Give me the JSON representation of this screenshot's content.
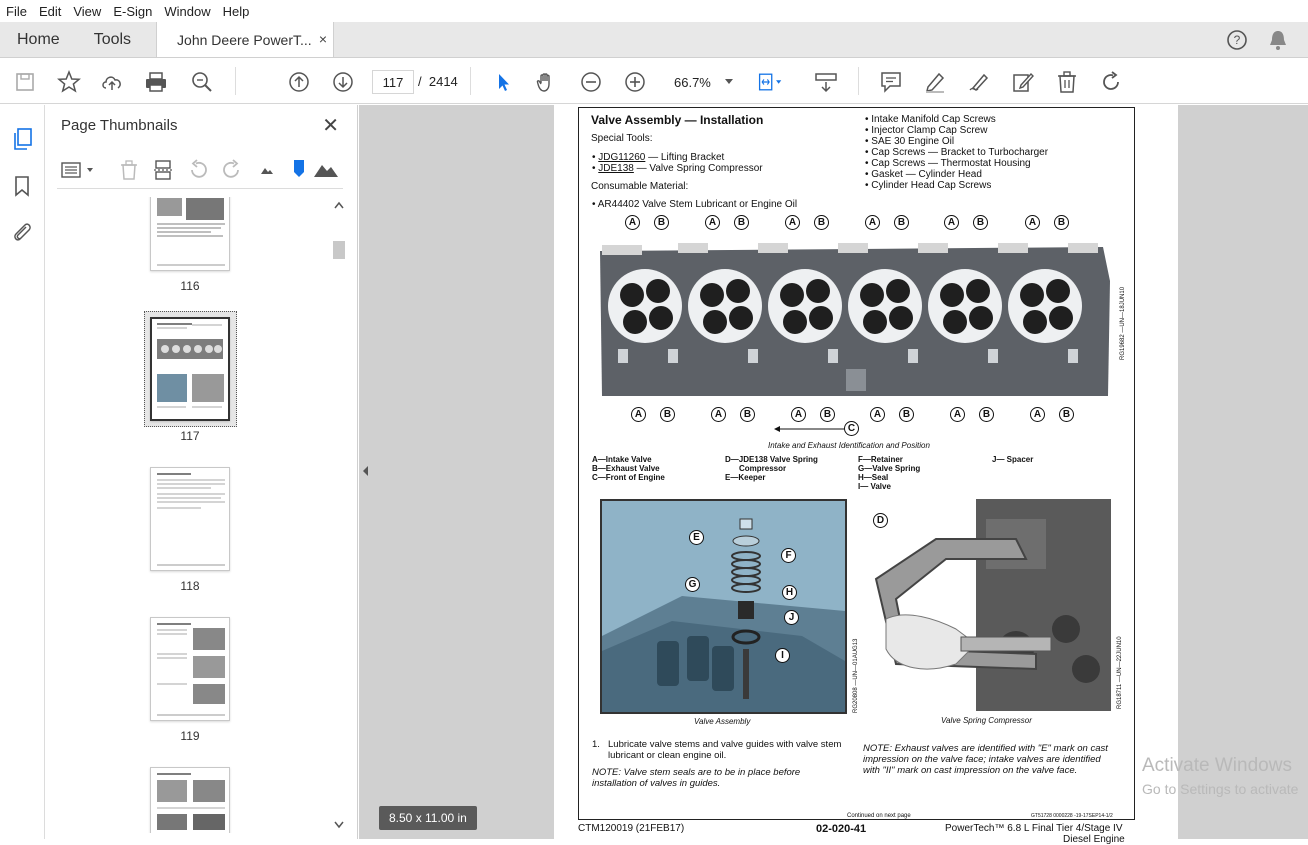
{
  "menu": [
    "File",
    "Edit",
    "View",
    "E-Sign",
    "Window",
    "Help"
  ],
  "tabs": {
    "home": "Home",
    "tools": "Tools",
    "document": "John Deere PowerT...",
    "close": "×"
  },
  "toolbar": {
    "current_page": "117",
    "page_sep": "/",
    "total_pages": "2414",
    "zoom": "66.7%"
  },
  "panel": {
    "title": "Page Thumbnails",
    "close": "✕"
  },
  "thumbnails": [
    {
      "label": "116"
    },
    {
      "label": "117"
    },
    {
      "label": "118"
    },
    {
      "label": "119"
    }
  ],
  "viewer": {
    "page_size": "8.50 x 11.00 in",
    "watermark_title": "Activate Windows",
    "watermark_sub": "Go to Settings to activate"
  },
  "document": {
    "title": "Valve Assembly — Installation",
    "special_tools_heading": "Special Tools:",
    "tools": [
      {
        "code": "JDG11260",
        "desc": " — Lifting Bracket"
      },
      {
        "code": "JDE138",
        "desc": " — Valve Spring Compressor"
      }
    ],
    "consumable_heading": "Consumable Material:",
    "consumable": "AR44402 Valve Stem Lubricant or Engine Oil",
    "right_list": [
      "Intake Manifold Cap Screws",
      "Injector Clamp Cap Screw",
      "SAE 30 Engine Oil",
      "Cap Screws — Bracket to Turbocharger",
      "Cap Screws — Thermostat Housing",
      "Gasket — Cylinder Head",
      "Cylinder Head Cap Screws"
    ],
    "callout_letters": {
      "a": "A",
      "b": "B",
      "c": "C",
      "d": "D",
      "e": "E",
      "f": "F",
      "g": "G",
      "h": "H",
      "i": "I",
      "j": "J"
    },
    "figure_id_1": "RG19682 —UN—18JUN10",
    "figure1_caption": "Intake and Exhaust Identification and Position",
    "legend": {
      "col1": [
        "A—Intake Valve",
        "B—Exhaust Valve",
        "C—Front of Engine"
      ],
      "col2": [
        "D—JDE138 Valve Spring",
        "Compressor",
        "E—Keeper"
      ],
      "col3": [
        "F—Retainer",
        "G—Valve Spring",
        "H—Seal",
        "I— Valve"
      ],
      "col4": [
        "J— Spacer"
      ]
    },
    "figure2_caption": "Valve Assembly",
    "figure2_id": "RG20808 —UN—01AUG13",
    "figure3_caption": "Valve Spring Compressor",
    "figure3_id": "RG18711 —UN—22JUN10",
    "step1_num": "1.",
    "step1": "Lubricate valve stems and valve guides with valve stem lubricant or clean engine oil.",
    "note1": "NOTE: Valve stem seals are to be in place before installation of valves in guides.",
    "note2": "NOTE: Exhaust valves are identified with \"E\" mark on cast impression on the valve face; intake valves are identified with \"II\" mark on cast impression on the valve face.",
    "continued": "Continued on next page",
    "doc_ref": "GT51728 0000228 -19-17SEP14-1/2",
    "footer_left": "CTM120019 (21FEB17)",
    "footer_center": "02-020-41",
    "footer_right": "PowerTech™ 6.8 L Final Tier 4/Stage IV",
    "footer_right2": "Diesel Engine"
  },
  "colors": {
    "accent": "#1473e6",
    "viewer_bg": "#d0d0d0",
    "photo_blue": "#8fb3c7"
  }
}
